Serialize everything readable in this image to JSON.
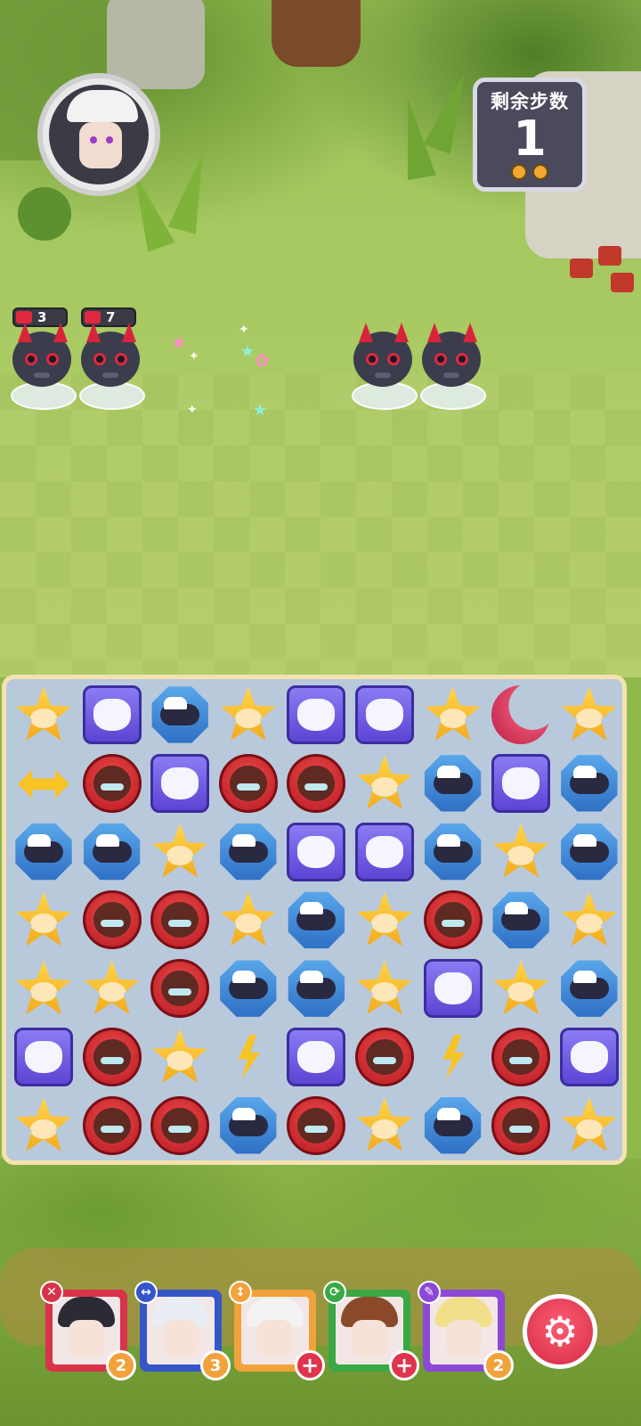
{
  "hud": {
    "moves_label": "剩余步数",
    "moves_count": "1"
  },
  "enemies": [
    {
      "hp": "3"
    },
    {
      "hp": "7"
    },
    {},
    {}
  ],
  "board": {
    "rows": [
      [
        "star",
        "purple",
        "blue",
        "star",
        "purple",
        "purple",
        "star",
        "moon",
        "star"
      ],
      [
        "arrows",
        "red",
        "purple",
        "red",
        "red",
        "star",
        "blue",
        "purple",
        "blue"
      ],
      [
        "blue",
        "blue",
        "star",
        "blue",
        "purple",
        "purple",
        "blue",
        "star",
        "blue"
      ],
      [
        "star",
        "red",
        "red",
        "star",
        "blue",
        "star",
        "red",
        "blue",
        "star"
      ],
      [
        "star",
        "star",
        "red",
        "blue",
        "blue",
        "star",
        "purple",
        "star",
        "blue"
      ],
      [
        "purple",
        "red",
        "star",
        "bolt",
        "purple",
        "red",
        "bolt",
        "red",
        "purple"
      ],
      [
        "star",
        "red",
        "red",
        "blue",
        "red",
        "star",
        "blue",
        "red",
        "star"
      ]
    ]
  },
  "heroes": [
    {
      "icon": "close-icon",
      "count": "2",
      "color": "#d8334a",
      "badge": "count"
    },
    {
      "icon": "swap-horizontal-icon",
      "count": "3",
      "color": "#3456c9",
      "badge": "count"
    },
    {
      "icon": "swap-vertical-icon",
      "count": "+",
      "color": "#f2a23a",
      "badge": "plus"
    },
    {
      "icon": "refresh-icon",
      "count": "+",
      "color": "#39a845",
      "badge": "plus"
    },
    {
      "icon": "pencil-icon",
      "count": "2",
      "color": "#8c48d6",
      "badge": "count"
    }
  ],
  "settings": {
    "icon": "gear-icon",
    "glyph": "⚙"
  }
}
